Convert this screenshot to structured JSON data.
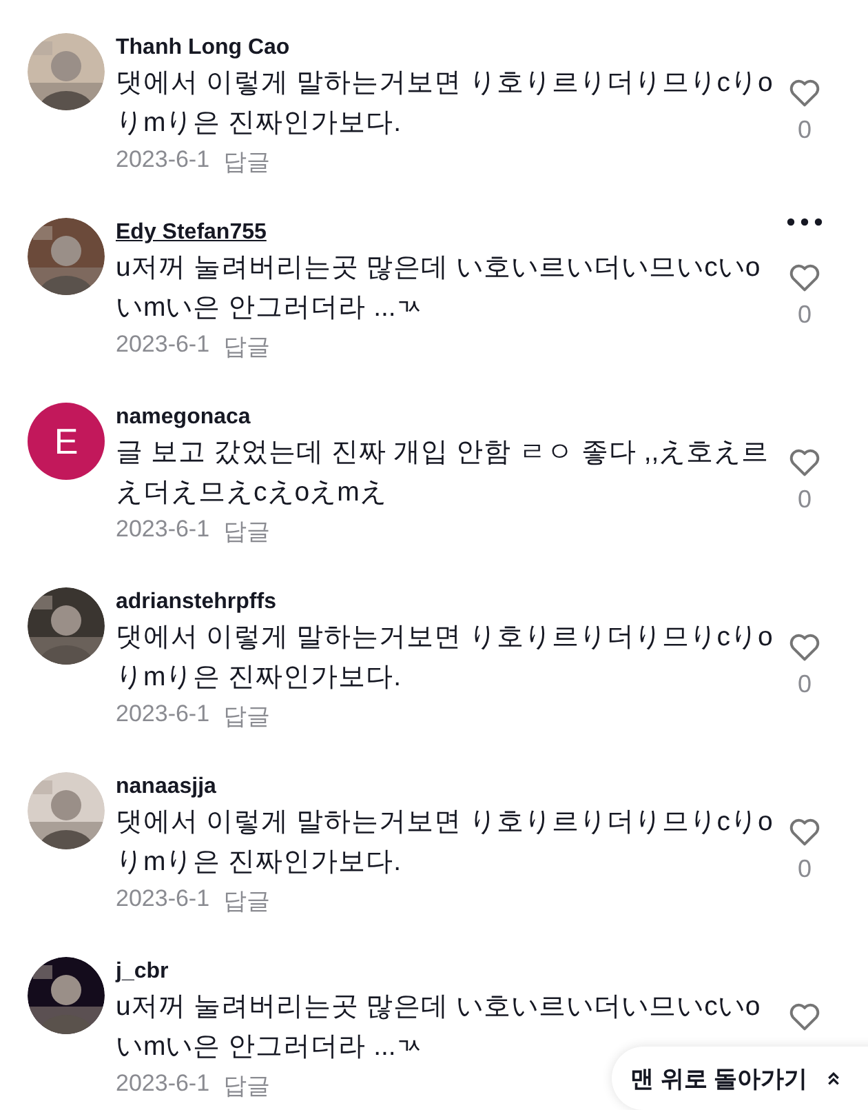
{
  "comments": [
    {
      "username": "Thanh Long Cao",
      "hovered": false,
      "text": "댓에서 이렇게 말하는거보면 り호り르り더り므りcりoりmり은 진짜인가보다.",
      "date": "2023-6-1",
      "reply": "답글",
      "likes": "0"
    },
    {
      "username": "Edy Stefan755",
      "hovered": true,
      "text": "u저꺼 눌려버리는곳 많은데 い호い르い더い므いcいoいmい은 안그러더라 ...ㄳ",
      "date": "2023-6-1",
      "reply": "답글",
      "likes": "0"
    },
    {
      "avatar": {
        "kind": "letter",
        "letter": "E",
        "color": "#c2185b"
      },
      "username": "namegonaca",
      "hovered": false,
      "text": "글 보고 갔었는데 진짜 개입 안함 ㄹㅇ 좋다 ,,え호え르え더え므えcえoえmえ",
      "date": "2023-6-1",
      "reply": "답글",
      "likes": "0"
    },
    {
      "username": "adrianstehrpffs",
      "hovered": false,
      "text": "댓에서 이렇게 말하는거보면 り호り르り더り므りcりoりmり은 진짜인가보다.",
      "date": "2023-6-1",
      "reply": "답글",
      "likes": "0"
    },
    {
      "username": "nanaasjja",
      "hovered": false,
      "text": "댓에서 이렇게 말하는거보면 り호り르り더り므りcりoりmり은 진짜인가보다.",
      "date": "2023-6-1",
      "reply": "답글",
      "likes": "0"
    },
    {
      "username": "j_cbr",
      "hovered": false,
      "text": "u저꺼 눌려버리는곳 많은데 い호い르い더い므いcいoいmい은 안그러더라 ...ㄳ",
      "date": "2023-6-1",
      "reply": "답글"
    }
  ],
  "back_to_top": {
    "label": "맨 위로 돌아가기"
  }
}
